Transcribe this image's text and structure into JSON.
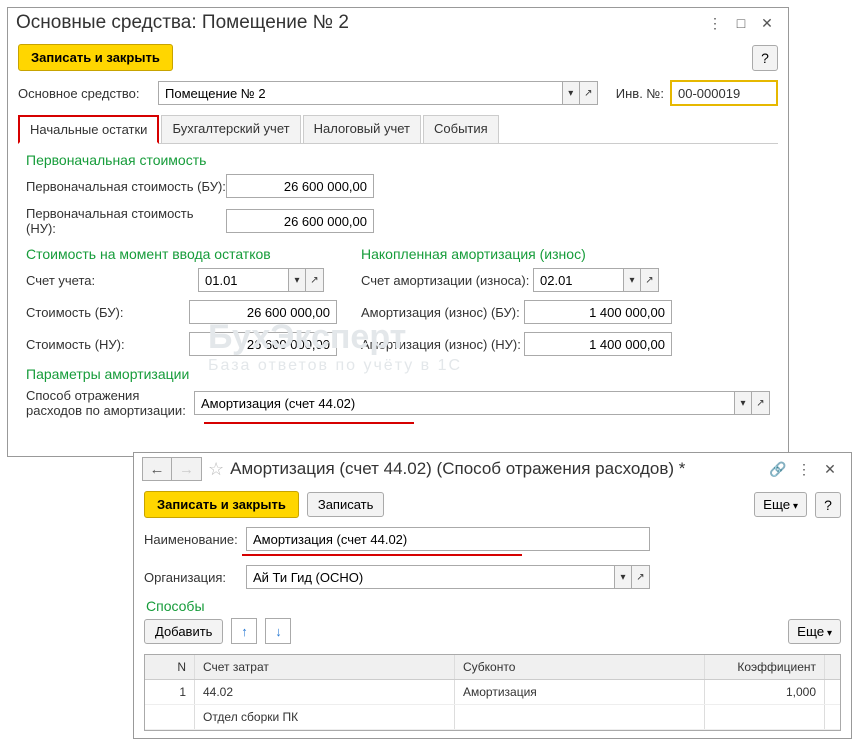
{
  "w1": {
    "title": "Основные средства: Помещение № 2",
    "save_close": "Записать и закрыть",
    "fa_label": "Основное средство:",
    "fa_value": "Помещение № 2",
    "inv_label": "Инв. №:",
    "inv_value": "00-000019",
    "tabs": [
      "Начальные остатки",
      "Бухгалтерский учет",
      "Налоговый учет",
      "События"
    ],
    "sec_initial": "Первоначальная стоимость",
    "init_bu_label": "Первоначальная стоимость (БУ):",
    "init_bu_value": "26 600 000,00",
    "init_nu_label": "Первоначальная стоимость (НУ):",
    "init_nu_value": "26 600 000,00",
    "sec_cost": "Стоимость на момент ввода остатков",
    "sec_accum": "Накопленная амортизация (износ)",
    "acct_label": "Счет учета:",
    "acct_value": "01.01",
    "cost_bu_label": "Стоимость (БУ):",
    "cost_bu_value": "26 600 000,00",
    "cost_nu_label": "Стоимость (НУ):",
    "cost_nu_value": "26 600 000,00",
    "dep_acct_label": "Счет амортизации (износа):",
    "dep_acct_value": "02.01",
    "dep_bu_label": "Амортизация (износ) (БУ):",
    "dep_bu_value": "1 400 000,00",
    "dep_nu_label": "Амортизация (износ) (НУ):",
    "dep_nu_value": "1 400 000,00",
    "sec_params": "Параметры амортизации",
    "expense_method_label": "Способ отражения расходов по амортизации:",
    "expense_method_value": "Амортизация (счет 44.02)"
  },
  "w2": {
    "title": "Амортизация (счет 44.02) (Способ отражения расходов) *",
    "save_close": "Записать и закрыть",
    "save": "Записать",
    "more": "Еще",
    "name_label": "Наименование:",
    "name_value": "Амортизация (счет 44.02)",
    "org_label": "Организация:",
    "org_value": "Ай Ти Гид (ОСНО)",
    "sec_methods": "Способы",
    "add": "Добавить",
    "th_n": "N",
    "th_acc": "Счет затрат",
    "th_sub": "Субконто",
    "th_coef": "Коэффициент",
    "row_n": "1",
    "row_acc": "44.02",
    "row_sub": "Амортизация",
    "row_coef": "1,000",
    "row_acc2": "Отдел сборки ПК"
  },
  "watermark_line1": "БухЭксперт",
  "watermark_line2": "База ответов по учёту в 1С"
}
